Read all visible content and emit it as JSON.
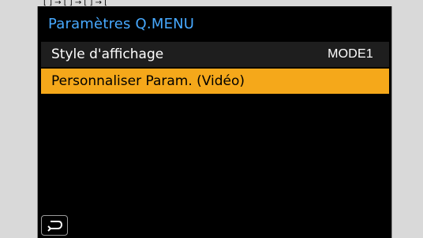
{
  "top_strip": {
    "text": "[ ] → [ ] → [ ] → ["
  },
  "screen": {
    "title": "Paramètres Q.MENU",
    "items": [
      {
        "label": "Style d'affichage",
        "value": "MODE1"
      },
      {
        "label": "Personnaliser Param. (Vidéo)",
        "value": ""
      }
    ],
    "back_icon": "return-arrow-icon",
    "colors": {
      "title": "#47a9ff",
      "selected_row": "#f5a81a",
      "background": "#000000"
    }
  }
}
